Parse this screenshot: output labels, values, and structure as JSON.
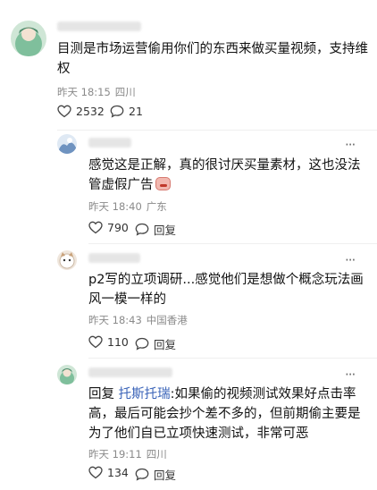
{
  "comments": [
    {
      "text": "目测是市场运营偷用你们的东西来做买量视频，支持维权",
      "time": "昨天 18:15",
      "location": "四川",
      "likes": "2532",
      "replies": "21"
    },
    {
      "text": "感觉这是正解，真的很讨厌买量素材，这也没法管虚假广告",
      "time": "昨天 18:40",
      "location": "广东",
      "likes": "790",
      "reply_label": "回复"
    },
    {
      "text": "p2写的立项调研...感觉他们是想做个概念玩法画风一模一样的",
      "time": "昨天 18:43",
      "location": "中国香港",
      "likes": "110",
      "reply_label": "回复"
    },
    {
      "reply_prefix": "回复 ",
      "mention": "托斯托瑞",
      "text": ":如果偷的视频测试效果好点击率高，最后可能会抄个差不多的，但前期偷主要是为了他们自已立项快速测试，非常可恶",
      "time": "昨天 19:11",
      "location": "四川",
      "likes": "134",
      "reply_label": "回复"
    }
  ],
  "icons": {
    "more": "more-dots-icon",
    "like": "heart-icon",
    "reply": "comment-bubble-icon"
  }
}
